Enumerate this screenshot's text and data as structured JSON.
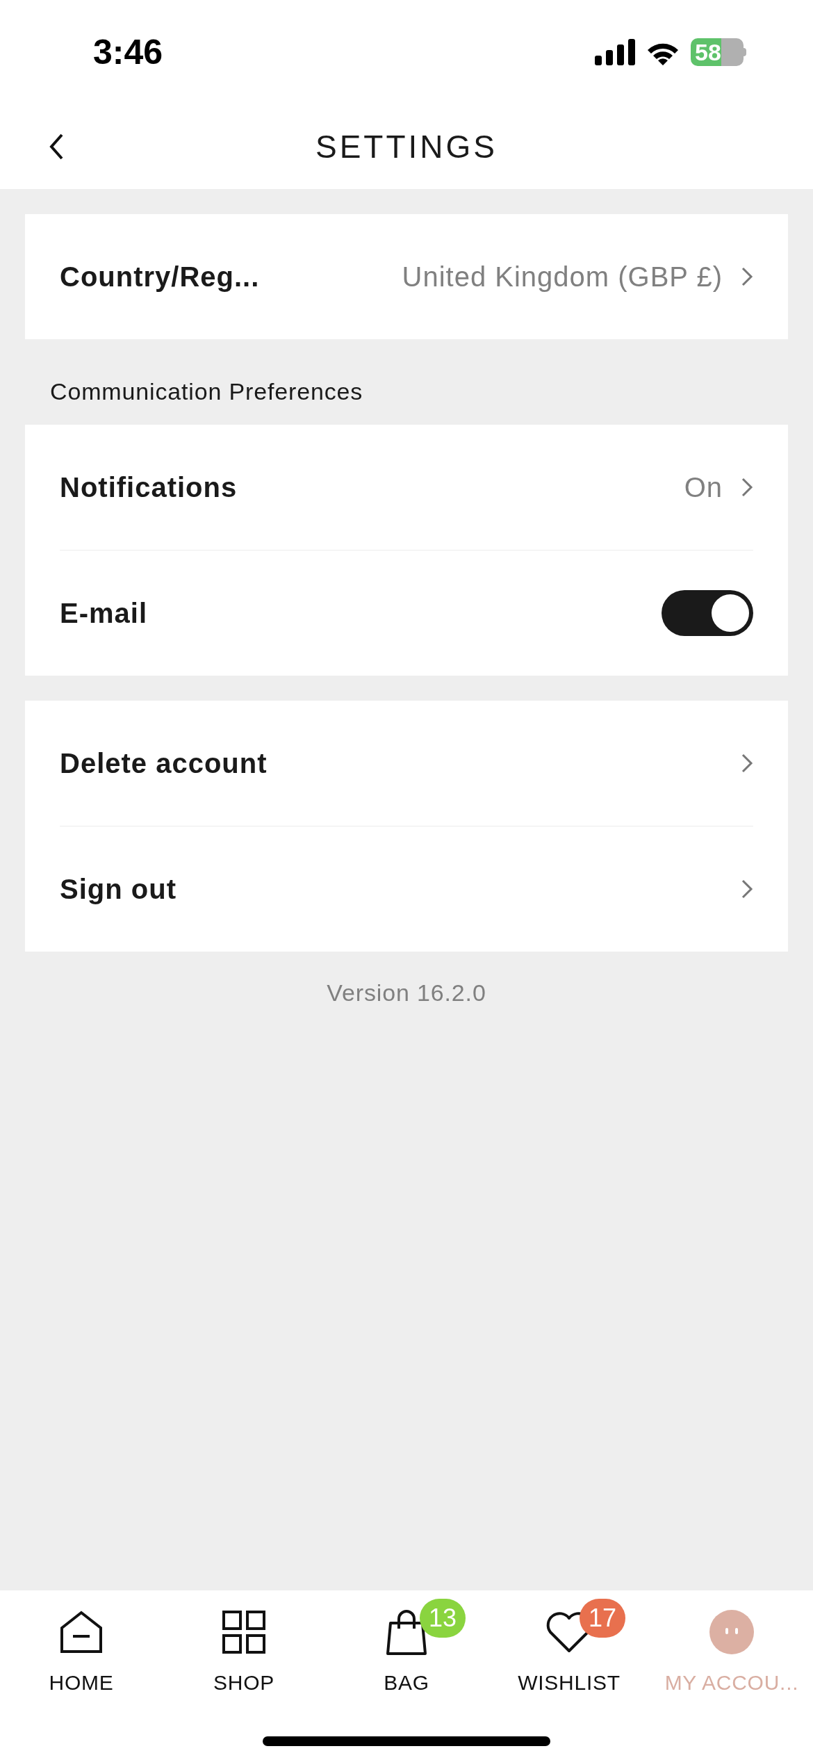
{
  "status_bar": {
    "time": "3:46",
    "battery": "58"
  },
  "header": {
    "title": "SETTINGS"
  },
  "groups": [
    {
      "items": [
        {
          "kind": "link",
          "label": "Country/Reg...",
          "value": "United Kingdom (GBP £)"
        }
      ]
    },
    {
      "heading": "Communication Preferences",
      "items": [
        {
          "kind": "link",
          "label": "Notifications",
          "value": "On"
        },
        {
          "kind": "toggle",
          "label": "E-mail",
          "on": true
        }
      ]
    },
    {
      "items": [
        {
          "kind": "link",
          "label": "Delete account"
        },
        {
          "kind": "link",
          "label": "Sign out"
        }
      ]
    }
  ],
  "version": "Version 16.2.0",
  "tab_bar": [
    {
      "kind": "home",
      "label": "HOME",
      "selected": false
    },
    {
      "kind": "shop",
      "label": "SHOP",
      "selected": false
    },
    {
      "kind": "bag",
      "label": "BAG",
      "selected": false,
      "badge": "13",
      "color": "#8ad43f"
    },
    {
      "kind": "wishlist",
      "label": "WISHLIST",
      "selected": false,
      "badge": "17",
      "color": "#e8704e"
    },
    {
      "kind": "account",
      "label": "MY ACCOU...",
      "selected": true
    }
  ]
}
